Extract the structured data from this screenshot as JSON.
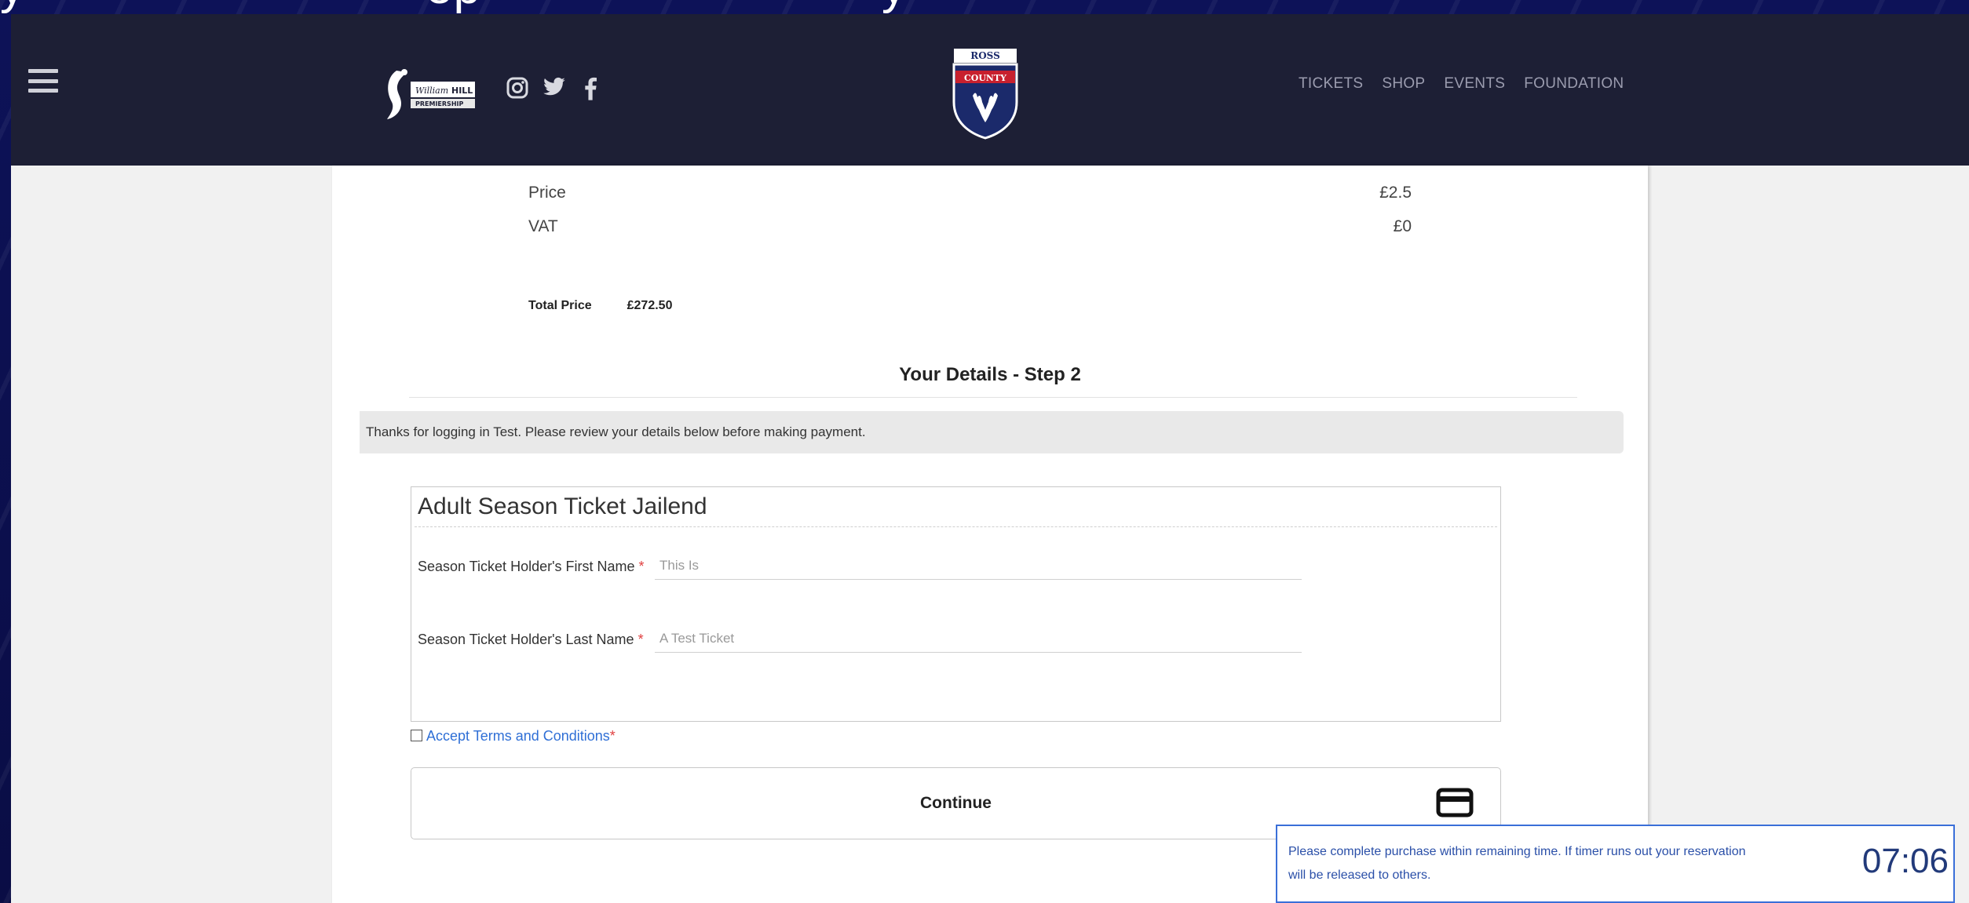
{
  "slide": {
    "left_text": "y",
    "right_text": "ep",
    "tail_text": "y"
  },
  "header": {
    "menu_icon": "hamburger-menu-icon",
    "league_logo": "william-hill-premiership-logo",
    "league_logo_text": "HILL",
    "league_logo_subtext": "PREMIERSHIP",
    "social": [
      "instagram-icon",
      "twitter-icon",
      "facebook-icon"
    ],
    "crest_top_text": "ROSS",
    "crest_band_text": "COUNTY",
    "nav": [
      {
        "label": "TICKETS"
      },
      {
        "label": "SHOP"
      },
      {
        "label": "EVENTS"
      },
      {
        "label": "FOUNDATION"
      }
    ]
  },
  "summary": {
    "price_label": "Price",
    "price_value": "£2.5",
    "vat_label": "VAT",
    "vat_value": "£0",
    "total_label": "Total Price",
    "total_value": "£272.50"
  },
  "details": {
    "title": "Your Details - Step 2",
    "thanks": "Thanks for logging in Test. Please review your details below before making payment."
  },
  "ticket": {
    "title": "Adult Season Ticket Jailend",
    "fields": [
      {
        "label": "Season Ticket Holder's First Name",
        "required": "*",
        "value": "This Is"
      },
      {
        "label": "Season Ticket Holder's Last Name",
        "required": "*",
        "value": "A Test Ticket"
      }
    ]
  },
  "terms": {
    "label": "Accept Terms and Conditions",
    "required": "*"
  },
  "continue": {
    "label": "Continue",
    "icon": "credit-card-icon"
  },
  "timer": {
    "message": "Please complete purchase within remaining time. If timer runs out your reservation will be released to others.",
    "countdown": "07:06"
  },
  "colors": {
    "header_bg": "#1d1f35",
    "backdrop": "#0b0f4a",
    "link": "#2f6fd6",
    "timer_border": "#3a6fd8"
  }
}
